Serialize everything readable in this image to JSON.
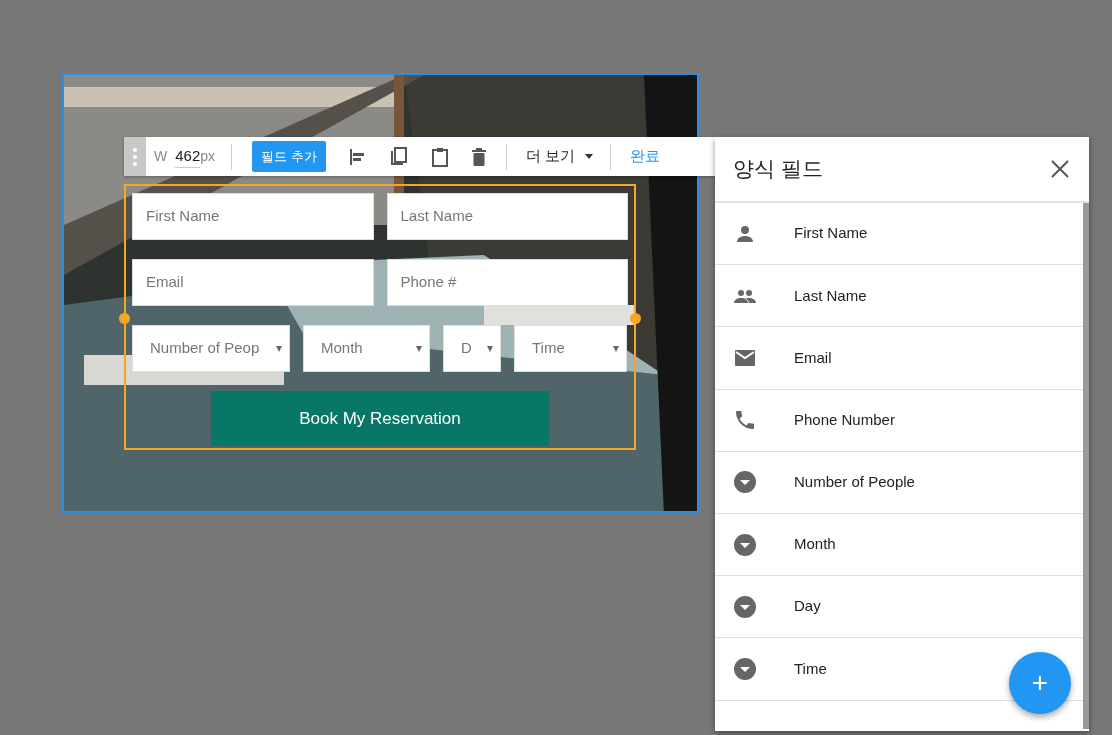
{
  "toolbar": {
    "width_label": "W",
    "width_value": "462",
    "width_unit": "px",
    "add_field_button": "필드 추가",
    "more_menu": "더 보기",
    "done_button": "완료"
  },
  "form": {
    "rows": [
      [
        {
          "kind": "text",
          "placeholder": "First Name"
        },
        {
          "kind": "text",
          "placeholder": "Last Name"
        }
      ],
      [
        {
          "kind": "text",
          "placeholder": "Email"
        },
        {
          "kind": "text",
          "placeholder": "Phone #"
        }
      ],
      [
        {
          "kind": "select",
          "placeholder": "Number of Peop"
        },
        {
          "kind": "select",
          "placeholder": "Month"
        },
        {
          "kind": "select",
          "placeholder": "D"
        },
        {
          "kind": "select",
          "placeholder": "Time"
        }
      ]
    ],
    "submit_button": "Book My Reservation"
  },
  "panel": {
    "title": "양식 필드",
    "items": [
      {
        "kind": "person",
        "label": "First Name"
      },
      {
        "kind": "people",
        "label": "Last Name"
      },
      {
        "kind": "email",
        "label": "Email"
      },
      {
        "kind": "phone",
        "label": "Phone Number"
      },
      {
        "kind": "dropdown",
        "label": "Number of People"
      },
      {
        "kind": "dropdown",
        "label": "Month"
      },
      {
        "kind": "dropdown",
        "label": "Day"
      },
      {
        "kind": "dropdown",
        "label": "Time"
      }
    ],
    "add_button": "+"
  }
}
